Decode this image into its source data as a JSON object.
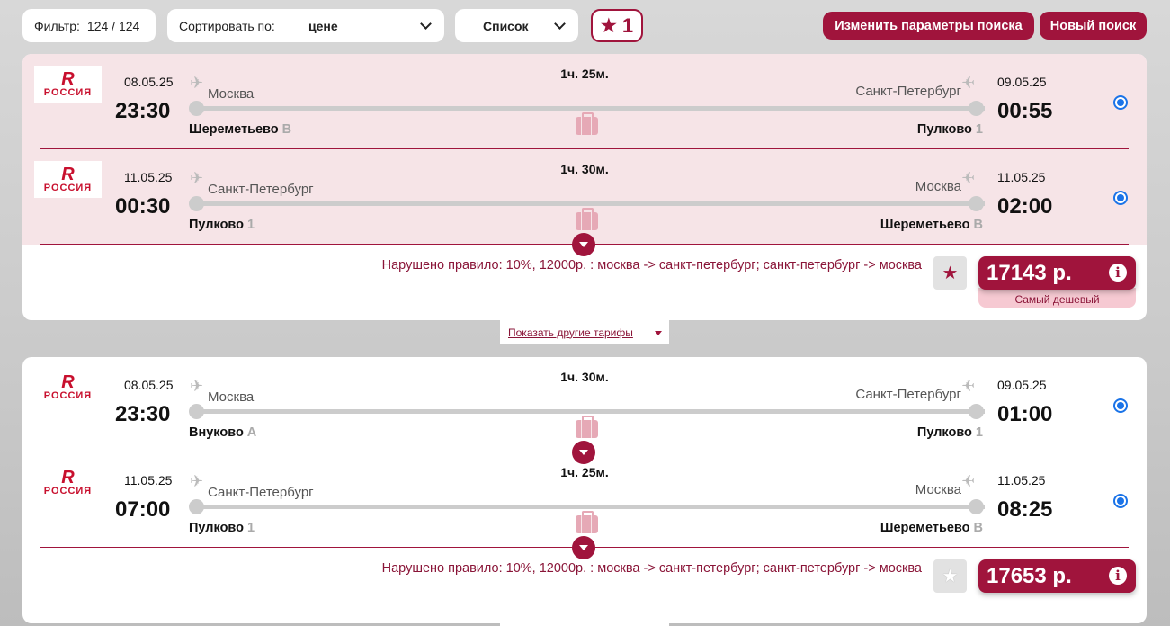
{
  "toolbar": {
    "filter_label": "Фильтр:",
    "filter_value": "124 / 124",
    "sort_label": "Сортировать по:",
    "sort_value": "цене",
    "view_value": "Список",
    "favorites_icon": "star-icon",
    "favorites_count": "1",
    "change_search_label": "Изменить параметры поиска",
    "new_search_label": "Новый поиск"
  },
  "colors": {
    "accent": "#a0143c",
    "pink_bg": "#f6e4e7",
    "radio": "#1a73e8"
  },
  "offers": [
    {
      "segments": [
        {
          "airline_logo_text": "РОССИЯ",
          "dep_date": "08.05.25",
          "dep_time": "23:30",
          "from_city": "Москва",
          "from_airport": "Шереметьево",
          "from_terminal": "B",
          "duration": "1ч. 25м.",
          "to_city": "Санкт-Петербург",
          "to_airport": "Пулково",
          "to_terminal": "1",
          "arr_date": "09.05.25",
          "arr_time": "00:55"
        },
        {
          "airline_logo_text": "РОССИЯ",
          "dep_date": "11.05.25",
          "dep_time": "00:30",
          "from_city": "Санкт-Петербург",
          "from_airport": "Пулково",
          "from_terminal": "1",
          "duration": "1ч. 30м.",
          "to_city": "Москва",
          "to_airport": "Шереметьево",
          "to_terminal": "B",
          "arr_date": "11.05.25",
          "arr_time": "02:00"
        }
      ],
      "rule_text": "Нарушено правило: 10%, 12000р. : москва -> санкт-петербург; санкт-петербург -> москва",
      "price": "17143 р.",
      "badge": "Самый дешевый",
      "favorite": true
    },
    {
      "segments": [
        {
          "airline_logo_text": "РОССИЯ",
          "dep_date": "08.05.25",
          "dep_time": "23:30",
          "from_city": "Москва",
          "from_airport": "Внуково",
          "from_terminal": "A",
          "duration": "1ч. 30м.",
          "to_city": "Санкт-Петербург",
          "to_airport": "Пулково",
          "to_terminal": "1",
          "arr_date": "09.05.25",
          "arr_time": "01:00"
        },
        {
          "airline_logo_text": "РОССИЯ",
          "dep_date": "11.05.25",
          "dep_time": "07:00",
          "from_city": "Санкт-Петербург",
          "from_airport": "Пулково",
          "from_terminal": "1",
          "duration": "1ч. 25м.",
          "to_city": "Москва",
          "to_airport": "Шереметьево",
          "to_terminal": "B",
          "arr_date": "11.05.25",
          "arr_time": "08:25"
        }
      ],
      "rule_text": "Нарушено правило: 10%, 12000р. : москва -> санкт-петербург; санкт-петербург -> москва",
      "price": "17653 р.",
      "favorite": false
    }
  ],
  "more_tariffs_label": "Показать другие тарифы"
}
